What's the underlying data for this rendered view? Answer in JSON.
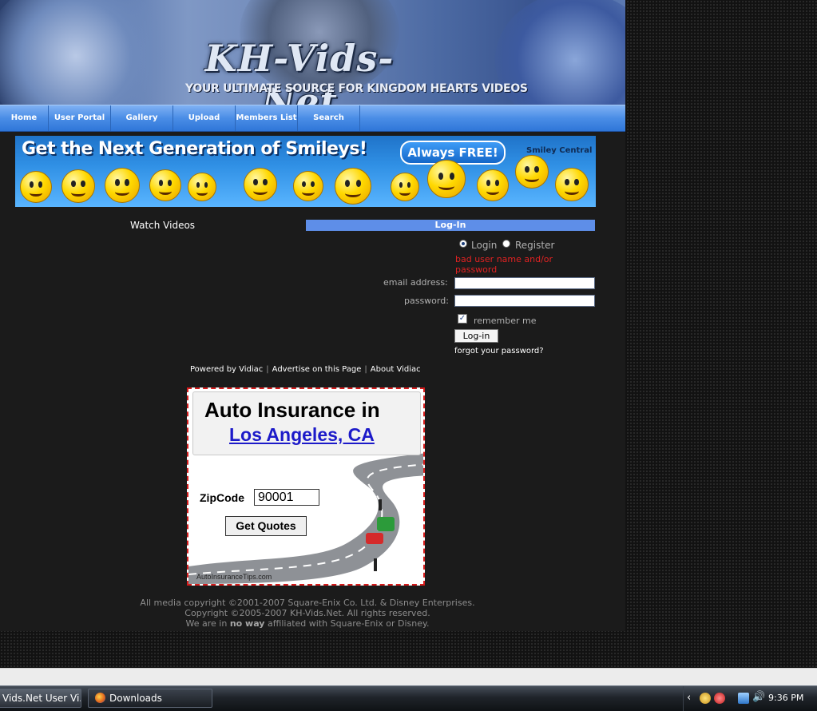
{
  "banner": {
    "logo": "KH-Vids-Net",
    "tagline": "YOUR ULTIMATE SOURCE FOR KINGDOM HEARTS VIDEOS"
  },
  "nav": {
    "items": [
      "Home",
      "User Portal",
      "Gallery",
      "Upload",
      "Members List",
      "Search"
    ]
  },
  "smiley_ad": {
    "headline": "Get the Next Generation of Smileys!",
    "pill": "Always FREE!",
    "brand": "Smiley Central"
  },
  "content": {
    "watch_videos": "Watch Videos"
  },
  "login": {
    "header": "Log-In",
    "option_login": "Login",
    "option_register": "Register",
    "error": "bad user name and/or password",
    "email_label": "email address:",
    "password_label": "password:",
    "email_value": "",
    "password_value": "",
    "remember_label": "remember me",
    "remember_checked": true,
    "button": "Log-in",
    "forgot": "forgot your password?"
  },
  "footer_links": {
    "powered": "Powered by Vidiac",
    "advertise": "Advertise on this Page",
    "about": "About Vidiac"
  },
  "auto_ad": {
    "title": "Auto Insurance in",
    "city": "Los Angeles, CA",
    "zip_label": "ZipCode",
    "zip_value": "90001",
    "button": "Get Quotes",
    "site": "AutoInsuranceTips.com"
  },
  "copyright": {
    "line1": "All media copyright ©2001-2007 Square-Enix Co. Ltd. & Disney Enterprises.",
    "line2": "Copyright ©2005-2007 KH-Vids.Net. All rights reserved.",
    "line3_pre": "We are in",
    "line3_bold": "no way",
    "line3_post": "affiliated with Square-Enix or Disney."
  },
  "taskbar": {
    "task1": "Vids.Net User Vi...",
    "task2": "Downloads",
    "clock": "9:36 PM"
  },
  "colors": {
    "nav_blue": "#3f86e2",
    "login_header": "#5e8ee8",
    "error_red": "#e02222",
    "ad_border": "#d51b1b",
    "link_blue": "#1c1ac9"
  }
}
